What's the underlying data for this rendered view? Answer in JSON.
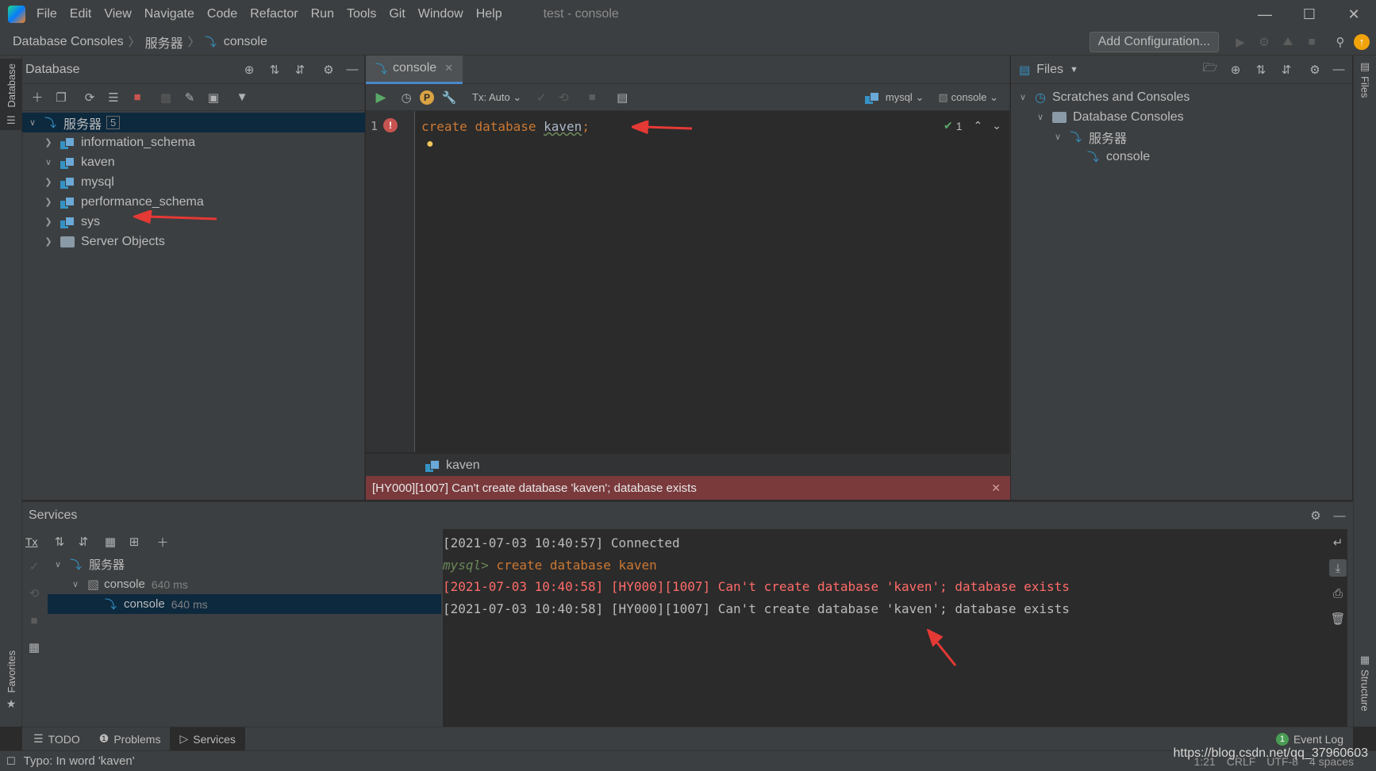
{
  "menubar": {
    "items": [
      "File",
      "Edit",
      "View",
      "Navigate",
      "Code",
      "Refactor",
      "Run",
      "Tools",
      "Git",
      "Window",
      "Help"
    ],
    "title": "test - console"
  },
  "navbar": {
    "breadcrumbs": [
      "Database Consoles",
      "服务器",
      "console"
    ],
    "add_configuration": "Add Configuration..."
  },
  "left_stripe": {
    "database": "Database",
    "favorites": "Favorites"
  },
  "db_panel": {
    "title": "Database",
    "root": {
      "label": "服务器",
      "count": "5"
    },
    "schemas": [
      "information_schema",
      "kaven",
      "mysql",
      "performance_schema",
      "sys"
    ],
    "server_objects": "Server Objects"
  },
  "editor": {
    "tab": "console",
    "tx": "Tx: Auto",
    "schema_selector": "mysql",
    "session_selector": "console",
    "line_number": "1",
    "code": {
      "kw1": "create",
      "kw2": "database",
      "ident": "kaven",
      "semi": ";"
    },
    "inspection_count": "1",
    "result_breadcrumb": "kaven",
    "error_message": "[HY000][1007] Can't create database 'kaven'; database exists"
  },
  "files_panel": {
    "title": "Files",
    "tree": [
      "Scratches and Consoles",
      "Database Consoles",
      "服务器",
      "console"
    ]
  },
  "right_stripe": {
    "files": "Files",
    "structure": "Structure"
  },
  "services": {
    "title": "Services",
    "tx": "Tx",
    "tree": {
      "root": "服务器",
      "session": {
        "label": "console",
        "time": "640 ms"
      },
      "child": {
        "label": "console",
        "time": "640 ms"
      }
    },
    "log": [
      {
        "text": "[2021-07-03 10:40:57] Connected",
        "type": "info"
      },
      {
        "prompt": "mysql>",
        "text": " create database kaven",
        "type": "cmd"
      },
      {
        "text": "[2021-07-03 10:40:58] [HY000][1007] Can't create database 'kaven'; database exists",
        "type": "error"
      },
      {
        "text": "[2021-07-03 10:40:58] [HY000][1007] Can't create database 'kaven'; database exists",
        "type": "info"
      }
    ]
  },
  "tool_tabs": {
    "todo": "TODO",
    "problems": "Problems",
    "services": "Services",
    "event_log": "Event Log",
    "event_count": "1"
  },
  "statusbar": {
    "message": "Typo: In word 'kaven'",
    "position": "1:21",
    "line_sep": "CRLF",
    "encoding": "UTF-8",
    "indent": "4 spaces",
    "watermark": "https://blog.csdn.net/qq_37960603"
  },
  "colors": {
    "accent": "#4a88c7",
    "error_bar": "#7a3a3c",
    "error_text": "#ff6b68",
    "keyword": "#cc7832",
    "run_green": "#59a869",
    "arrow": "#e53935"
  }
}
